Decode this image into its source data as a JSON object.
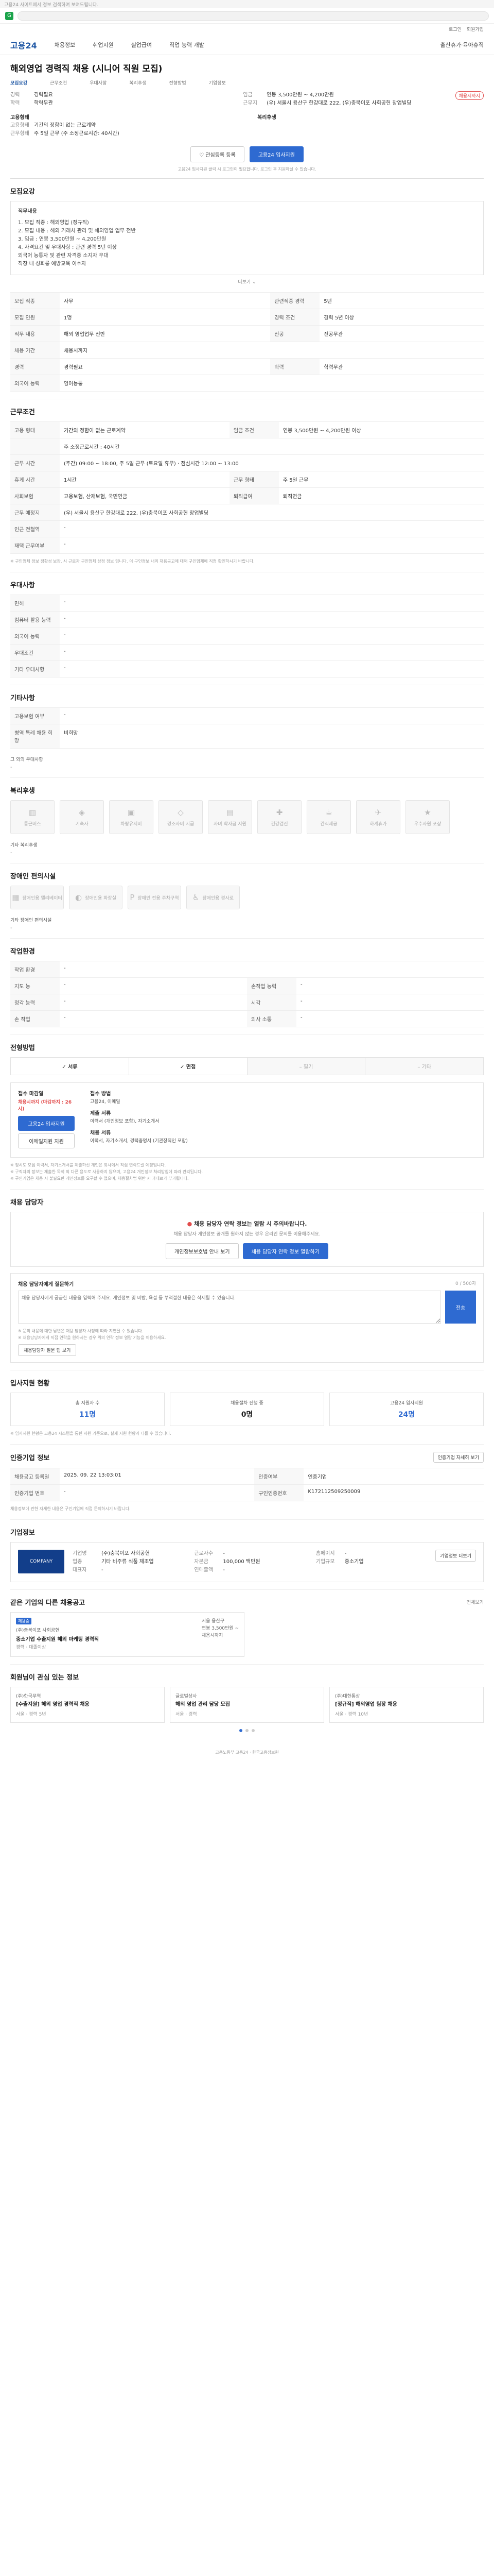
{
  "browser": {
    "notice": "고용24 사이트에서 정보 검색하여 보여드립니다.",
    "favicon": "G"
  },
  "util": {
    "items": [
      "로그인",
      "회원가입"
    ]
  },
  "gnb": {
    "logo": "고용24",
    "menu": [
      "채용정보",
      "취업지원",
      "실업급여",
      "직업 능력 개발",
      "출산휴가·육아휴직"
    ]
  },
  "job": {
    "title": "해외영업 경력직 채용 (시니어 직원 모집)",
    "tabs": [
      "모집요강",
      "근무조건",
      "우대사항",
      "복리후생",
      "전형방법",
      "기업정보"
    ],
    "badge": "채용시까지",
    "left": [
      {
        "k": "경력",
        "v": "경력필요"
      },
      {
        "k": "학력",
        "v": "학력무관"
      }
    ],
    "right": [
      {
        "k": "임금",
        "v": "연봉 3,500만원 ~ 4,200만원"
      },
      {
        "k": "근무지",
        "v": "(우) 서울시 용산구 한강대로 222, (우)충북이포 사회공헌 창업빌딩"
      }
    ],
    "employ_label": "고용형태",
    "employ": [
      {
        "k": "고용형태",
        "v": "기간의 정함이 없는 근로계약"
      },
      {
        "k": "근무형태",
        "v": "주 5일 근무 (주 소정근로시간: 40시간)"
      }
    ],
    "welfare_label": "복리후생",
    "save_btn": "관심등록 등록",
    "apply_btn": "고용24 입사지원",
    "notice": "고용24 입사지원 클릭 시 로그인이 필요합니다. 로그인 후 지원하실 수 있습니다."
  },
  "duties": {
    "title": "모집요강",
    "box_title": "직무내용",
    "lines": [
      "1. 모집 직종 : 해외영업 (정규직)",
      "2. 모집 내용 : 해외 거래처 관리 및 해외영업 업무 전반",
      "3. 임금 : 연봉 3,500만원 ~ 4,200만원",
      "4. 자격요건 및 우대사항 : 관련 경력 5년 이상",
      "   외국어 능통자 및 관련 자격증 소지자 우대",
      "   직장 내 성희롱 예방교육 이수자"
    ],
    "more": "더보기"
  },
  "recruit_table": [
    [
      {
        "k": "모집 직종",
        "v": "사무"
      },
      {
        "k": "관련직종 경력",
        "v": "5년"
      }
    ],
    [
      {
        "k": "모집 인원",
        "v": "1명"
      },
      {
        "k": "경력 조건",
        "v": "경력 5년 이상"
      }
    ],
    [
      {
        "k": "직무 내용",
        "v": "해외 영업업무 전반"
      },
      {
        "k": "전공",
        "v": "전공무관"
      }
    ],
    [
      {
        "k": "채용 기간",
        "v": "채용시까지"
      }
    ],
    [
      {
        "k": "경력",
        "v": "경력필요"
      },
      {
        "k": "학력",
        "v": "학력무관"
      }
    ],
    [
      {
        "k": "외국어 능력",
        "v": "영어능통"
      }
    ]
  ],
  "conditions": {
    "title": "근무조건",
    "rows": [
      [
        {
          "k": "고용 형태",
          "v": "기간의 정함이 없는 근로계약"
        },
        {
          "k": "임금 조건",
          "v": "연봉 3,500만원 ~ 4,200만원 이상"
        }
      ],
      [
        {
          "k": "",
          "v": "주 소정근로시간 : 40시간"
        }
      ],
      [
        {
          "k": "근무 시간",
          "v": "(주간) 09:00 ~ 18:00, 주 5일 근무 (토요일 휴무) · 점심시간 12:00 ~ 13:00"
        }
      ],
      [
        {
          "k": "휴게 시간",
          "v": "1시간"
        },
        {
          "k": "근무 형태",
          "v": "주 5일 근무"
        }
      ],
      [
        {
          "k": "사회보험",
          "v": "고용보험, 산재보험, 국민연금"
        },
        {
          "k": "퇴직급여",
          "v": "퇴직연금"
        }
      ],
      [
        {
          "k": "근무 예정지",
          "v": "(우) 서울시 용산구 한강대로 222, (우)충북이포 사회공헌 창업빌딩"
        }
      ],
      [
        {
          "k": "인근 전철역",
          "v": "-"
        }
      ],
      [
        {
          "k": "재택 근무여부",
          "v": "-"
        }
      ]
    ],
    "note": "※ 구인업체 정보 정확성 보장, 시 근로자 구인업체 상정 정보 입니다. 이 구인정보 내의 채용공고에 대해 구인업체에 직접 확인하시기 바랍니다."
  },
  "preferences": {
    "title": "우대사항",
    "rows": [
      {
        "k": "면허",
        "v": "-"
      },
      {
        "k": "컴퓨터 활용 능력",
        "v": "-"
      },
      {
        "k": "외국어 능력",
        "v": "-"
      },
      {
        "k": "우대조건",
        "v": "-"
      },
      {
        "k": "기타 우대사항",
        "v": "-"
      }
    ]
  },
  "others": {
    "title": "기타사항",
    "rows": [
      {
        "k": "고용보험 여부",
        "v": "-"
      },
      {
        "k": "병역 특례 채용 희망",
        "v": "비희망"
      }
    ],
    "extra_label": "그 외의 우대사항",
    "extra_value": "-"
  },
  "welfare": {
    "title": "복리후생",
    "items": [
      {
        "icon": "building-icon",
        "glyph": "▥",
        "label": "통근버스"
      },
      {
        "icon": "meal-icon",
        "glyph": "◈",
        "label": "기숙사"
      },
      {
        "icon": "bus-icon",
        "glyph": "▣",
        "label": "차량유지비"
      },
      {
        "icon": "gift-icon",
        "glyph": "◇",
        "label": "경조사비 지급"
      },
      {
        "icon": "dorm-icon",
        "glyph": "▤",
        "label": "자녀 학자금 지원"
      },
      {
        "icon": "health-icon",
        "glyph": "✚",
        "label": "건강검진"
      },
      {
        "icon": "coffee-icon",
        "glyph": "☕",
        "label": "간식제공"
      },
      {
        "icon": "vacation-icon",
        "glyph": "✈",
        "label": "하계휴가"
      },
      {
        "icon": "award-icon",
        "glyph": "★",
        "label": "우수사원 포상"
      }
    ],
    "extra_label": "기타 복리후생",
    "extra_value": "-"
  },
  "disability": {
    "title": "장애인 편의시설",
    "items": [
      {
        "icon": "elevator-icon",
        "glyph": "▦",
        "label": "장애인용 엘리베이터"
      },
      {
        "icon": "toilet-icon",
        "glyph": "◐",
        "label": "장애인용 화장실"
      },
      {
        "icon": "parking-icon",
        "glyph": "P",
        "label": "장애인 전용 주차구역"
      },
      {
        "icon": "ramp-icon",
        "glyph": "♿",
        "label": "장애인용 경사로"
      }
    ],
    "extra_label": "기타 장애인 편의시설",
    "extra_value": "-"
  },
  "workplace": {
    "title": "작업환경",
    "rows": [
      [
        {
          "k": "작업 환경",
          "v": "-"
        }
      ],
      [
        {
          "k": "지도 능",
          "v": "-"
        },
        {
          "k": "손작업 능력",
          "v": "-"
        }
      ],
      [
        {
          "k": "청각 능력",
          "v": "-"
        },
        {
          "k": "시각",
          "v": "-"
        }
      ],
      [
        {
          "k": "손 작업",
          "v": "-"
        },
        {
          "k": "의사 소통",
          "v": "-"
        }
      ]
    ]
  },
  "process": {
    "title": "전형방법",
    "steps": [
      {
        "label": "서류",
        "on": true
      },
      {
        "label": "면접",
        "on": true
      },
      {
        "label": "필기",
        "on": false
      },
      {
        "label": "기타",
        "on": false
      }
    ],
    "deadline_label": "접수 마감일",
    "deadline": "채용시까지 (마감까지 : 26시)",
    "apply_btn": "고용24 입사지원",
    "email_btn": "이메일지원 지원",
    "method_label": "접수 방법",
    "method": "고용24, 이메일",
    "docs_label": "제출 서류",
    "docs": "이력서 (개인정보 포함), 자기소개서",
    "docs2_label": "채용 서류",
    "docs2": "이력서, 자기소개서, 경력증명서 (기관장직인 포함)",
    "warnings": [
      "※ 정시도 모집 이력서, 자기소개서를 제출하신 개인은 회사에서 직접 연락드릴 예정입니다.",
      "※ 구직자의 정보는 제출한 목적 외 다른 용도로 사용하지 않으며, 고용24 개인정보 처리방침에 따라 관리됩니다.",
      "※ 구인기업은 채용 시 불필요한 개인정보를 요구할 수 없으며, 채용절차법 위반 시 과태료가 부과됩니다."
    ]
  },
  "contact": {
    "title": "채용 담당자",
    "alert_title": "채용 담당자 연락 정보는 열람 시 주의바랍니다.",
    "alert_desc": "채용 담당자 개인정보 공개를 원하지 않는 경우 온라인 문의를 이용해주세요.",
    "btn1": "개인정보보호법 안내 보기",
    "btn2": "채용 담당자 연락 정보 열람하기",
    "inquiry_title": "채용 담당자에게 질문하기",
    "inquiry_count": "0 / 500자",
    "inquiry_placeholder": "채용 담당자에게 궁금한 내용을 입력해 주세요. 개인정보 및 비방, 욕설 등 부적절한 내용은 삭제될 수 있습니다.",
    "inquiry_btn": "전송",
    "notes": [
      "※ 문의 내용에 대한 답변은 채용 담당자 사정에 따라 지연될 수 있습니다.",
      "※ 채용담당자에게 직접 연락을 원하시는 경우 위의 연락 정보 열람 기능을 이용하세요."
    ],
    "tip_link": "채용담당자 질문 팁 보기"
  },
  "stats": {
    "title": "입사지원 현황",
    "items": [
      {
        "label": "총 지원자 수",
        "value": "11명"
      },
      {
        "label": "채용절차 진행 중",
        "value": "0명"
      },
      {
        "label": "고용24 입사지원",
        "value": "24명"
      }
    ],
    "note": "※ 입사지원 현황은 고용24 시스템을 통한 지원 기준으로, 실제 지원 현황과 다를 수 있습니다."
  },
  "reg": {
    "title": "인증기업 정보",
    "link": "인증기업 자세히 보기",
    "rows": [
      [
        {
          "k": "채용공고 등록일",
          "v": "2025. 09. 22 13:03:01"
        },
        {
          "k": "인증여부",
          "v": "인증기업"
        }
      ],
      [
        {
          "k": "인증기업 번호",
          "v": "-"
        },
        {
          "k": "구인인증번호",
          "v": "K172112509250009"
        }
      ]
    ],
    "note": "채용정보에 관한 자세한 내용은 구인기업에 직접 문의하시기 바랍니다."
  },
  "company": {
    "title": "기업정보",
    "logo_text": "COMPANY",
    "cols": [
      [
        {
          "k": "기업명",
          "v": "(주)충북이포 사회공헌"
        },
        {
          "k": "업종",
          "v": "기타 비주류 식품 제조업"
        },
        {
          "k": "대표자",
          "v": "-"
        }
      ],
      [
        {
          "k": "근로자수",
          "v": "-"
        },
        {
          "k": "자본금",
          "v": "100,000 백만원"
        },
        {
          "k": "연매출액",
          "v": "-"
        }
      ],
      [
        {
          "k": "홈페이지",
          "v": "-"
        },
        {
          "k": "기업규모",
          "v": "중소기업"
        }
      ]
    ],
    "detail_btn": "기업정보 더보기"
  },
  "similar": {
    "title": "같은 기업의 다른 채용공고",
    "link": "전체보기",
    "cards": [
      {
        "tag": "채용중",
        "company": "(주)충북이포 사회공헌",
        "title": "중소기업 수출지원 해외 마케팅 경력직",
        "meta": "경력 · 대졸이상",
        "right": [
          "서울 용산구",
          "연봉 3,500만원 ~",
          "채용시까지"
        ]
      }
    ]
  },
  "recommend": {
    "title": "회원님이 관심 있는 정보",
    "cards": [
      {
        "company": "(주)한국무역",
        "title": "[수출지원] 해외 영업 경력직 채용",
        "meta": "서울 · 경력 5년"
      },
      {
        "company": "글로벌상사",
        "title": "해외 영업 관리 담당 모집",
        "meta": "서울 · 경력"
      },
      {
        "company": "(주)대한통상",
        "title": "[정규직] 해외영업 팀장 채용",
        "meta": "서울 · 경력 10년"
      }
    ]
  },
  "footer": {
    "text": "고용노동부 고용24 · 한국고용정보원"
  }
}
